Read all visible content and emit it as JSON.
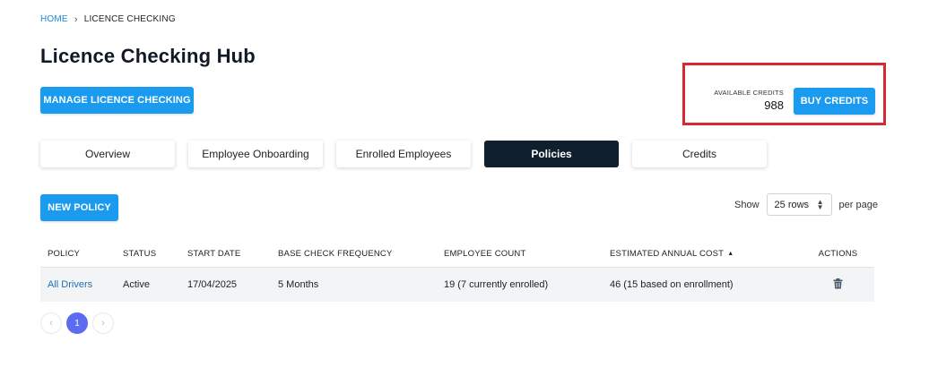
{
  "breadcrumb": {
    "home": "HOME",
    "separator": "›",
    "current": "LICENCE CHECKING"
  },
  "page": {
    "title": "Licence Checking Hub"
  },
  "actions": {
    "manage_label": "MANAGE LICENCE CHECKING",
    "new_policy_label": "NEW POLICY"
  },
  "credits": {
    "label": "AVAILABLE CREDITS",
    "value": "988",
    "buy_label": "BUY CREDITS"
  },
  "tabs": [
    {
      "label": "Overview",
      "active": false
    },
    {
      "label": "Employee Onboarding",
      "active": false
    },
    {
      "label": "Enrolled Employees",
      "active": false
    },
    {
      "label": "Policies",
      "active": true
    },
    {
      "label": "Credits",
      "active": false
    }
  ],
  "pagesize": {
    "show_label": "Show",
    "selected": "25 rows",
    "suffix": "per page"
  },
  "table": {
    "headers": [
      "POLICY",
      "STATUS",
      "START DATE",
      "BASE CHECK FREQUENCY",
      "EMPLOYEE COUNT",
      "ESTIMATED ANNUAL COST",
      "ACTIONS"
    ],
    "sort_indicator": "▲",
    "rows": [
      {
        "policy": "All Drivers",
        "status": "Active",
        "start_date": "17/04/2025",
        "frequency": "5 Months",
        "employee_count": "19 (7 currently enrolled)",
        "annual_cost": "46 (15 based on enrollment)"
      }
    ]
  },
  "pagination": {
    "prev": "‹",
    "current": "1",
    "next": "›"
  },
  "colors": {
    "primary": "#1a9bf0",
    "active_tab": "#0f1f2e",
    "highlight_border": "#d52a34",
    "page_active": "#5b6cf0",
    "link": "#1f6fb5"
  },
  "icons": {
    "delete": "trash-icon",
    "breadcrumb_separator": "chevron-right-icon"
  }
}
